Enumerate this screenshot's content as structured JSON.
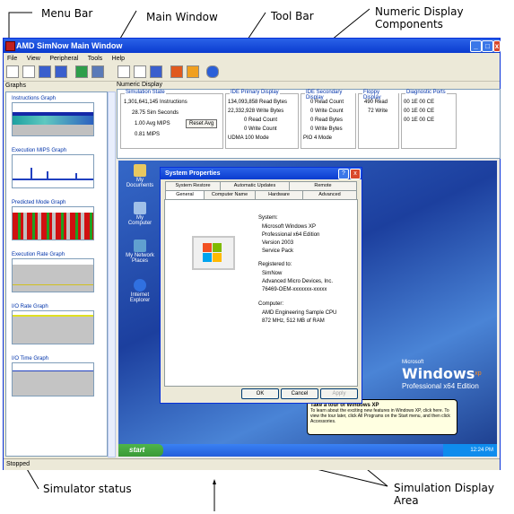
{
  "annotations": {
    "menu_bar": "Menu Bar",
    "main_window": "Main Window",
    "tool_bar": "Tool Bar",
    "numeric_display": "Numeric Display\nComponents",
    "simulator_status": "Simulator status",
    "simulation_display": "Simulation Display\nArea"
  },
  "window": {
    "title": "AMD SimNow Main Window",
    "menu": [
      "File",
      "View",
      "Peripheral",
      "Tools",
      "Help"
    ]
  },
  "toolbar_icons": [
    "new-icon",
    "open-icon",
    "save-icon",
    "save-as-icon",
    "reset-icon",
    "monitor-icon",
    "play-icon",
    "pause-icon",
    "step-icon",
    "breakpoint-icon",
    "debug-icon",
    "help-icon"
  ],
  "left_pane": {
    "header": "Graphs",
    "graphs": [
      {
        "label": "Instructions Graph"
      },
      {
        "label": "Execution MIPS Graph"
      },
      {
        "label": "Predicted Mode Graph"
      },
      {
        "label": "Execution Rate Graph"
      },
      {
        "label": "I/O Rate Graph"
      },
      {
        "label": "I/O Time Graph"
      }
    ]
  },
  "numeric": {
    "header": "Numeric Display",
    "sim_state": {
      "title": "Simulation State",
      "rows": [
        "1,301,641,145 Instructions",
        "28.75 Sim Seconds",
        "1.00 Avg MIPS",
        "0.81 MIPS"
      ],
      "button": "Reset Avg"
    },
    "ide_primary": {
      "title": "IDE Primary Display",
      "rows": [
        "134,093,858 Read Bytes",
        "22,332,928 Write Bytes",
        "0 Read Count",
        "0 Write Count",
        "UDMA 100 Mode"
      ]
    },
    "ide_secondary": {
      "title": "IDE Secondary Display",
      "rows": [
        "0 Read Count",
        "0 Write Count",
        "0 Read Bytes",
        "0 Write Bytes",
        "PIO 4 Mode"
      ]
    },
    "floppy": {
      "title": "Floppy Display",
      "rows": [
        "490 Read",
        "72 Write"
      ]
    },
    "diag": {
      "title": "Diagnostic Ports",
      "rows": [
        [
          "00",
          "1E",
          "00",
          "CE"
        ],
        [
          "00",
          "1E",
          "00",
          "CE"
        ],
        [
          "00",
          "1E",
          "00",
          "CE"
        ]
      ]
    }
  },
  "desktop": {
    "icons": [
      "My Documents",
      "My Computer",
      "My Network Places",
      "Internet Explorer"
    ],
    "start": "start",
    "clock": "12:24 PM",
    "logo_ms": "Microsoft",
    "logo_windows": "Windows",
    "logo_xp": "xp",
    "logo_edition": "Professional x64 Edition",
    "balloon_title": "Take a tour of Windows XP",
    "balloon_text": "To learn about the exciting new features in Windows XP, click here. To view the tour later, click All Programs on the Start menu, and then click Accessories."
  },
  "dialog": {
    "title": "System Properties",
    "tabs_top": [
      "System Restore",
      "Automatic Updates",
      "Remote"
    ],
    "tabs_bottom": [
      "General",
      "Computer Name",
      "Hardware",
      "Advanced"
    ],
    "system_label": "System:",
    "system": [
      "Microsoft Windows XP",
      "Professional x64 Edition",
      "Version 2003",
      "Service Pack"
    ],
    "registered_label": "Registered to:",
    "registered": [
      "SimNow",
      "Advanced Micro Devices, Inc.",
      "76469-OEM-xxxxxxx-xxxxx"
    ],
    "computer_label": "Computer:",
    "computer": [
      "AMD Engineering Sample CPU",
      "872 MHz, 512 MB of RAM"
    ],
    "buttons": [
      "OK",
      "Cancel",
      "Apply"
    ]
  },
  "status": {
    "text": "Stopped"
  }
}
